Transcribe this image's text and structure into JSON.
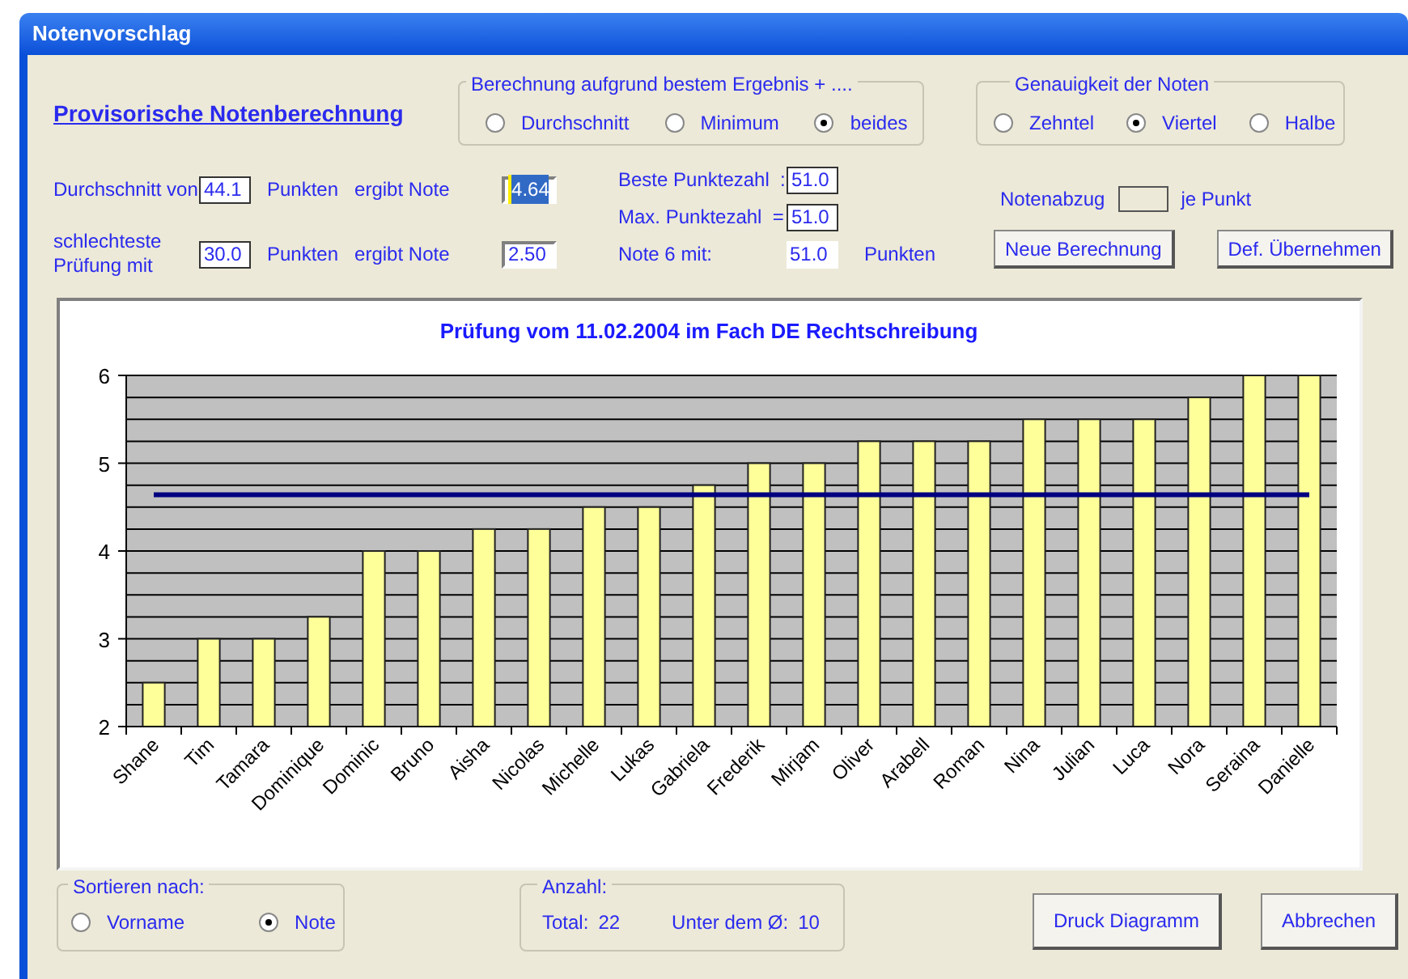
{
  "window": {
    "title": "Notenvorschlag"
  },
  "heading": "Provisorische Notenberechnung",
  "calc_group": {
    "title": "Berechnung aufgrund bestem Ergebnis + ....",
    "options": [
      {
        "label": "Durchschnitt",
        "selected": false
      },
      {
        "label": "Minimum",
        "selected": false
      },
      {
        "label": "beides",
        "selected": true
      }
    ]
  },
  "precision_group": {
    "title": "Genauigkeit der Noten",
    "options": [
      {
        "label": "Zehntel",
        "selected": false
      },
      {
        "label": "Viertel",
        "selected": true
      },
      {
        "label": "Halbe",
        "selected": false
      }
    ]
  },
  "average_row": {
    "label": "Durchschnitt von",
    "points": "44.1",
    "points_unit": "Punkten",
    "result_label": "ergibt Note",
    "grade": "4.64",
    "grade_highlighted": true
  },
  "worst_row": {
    "label_lines": [
      "schlechteste",
      "Prüfung mit"
    ],
    "points": "30.0",
    "points_unit": "Punkten",
    "result_label": "ergibt Note",
    "grade": "2.50",
    "grade_highlighted": false
  },
  "best_score": {
    "label": "Beste Punktezahl  :",
    "value": "51.0"
  },
  "max_score": {
    "label": "Max. Punktezahl  =",
    "value": "51.0"
  },
  "grade6": {
    "label": "Note 6 mit:",
    "value": "51.0",
    "unit": "Punkten"
  },
  "deduction": {
    "label": "Notenabzug",
    "unit": "je Punkt"
  },
  "top_buttons": [
    "Neue Berechnung",
    "Def. Übernehmen"
  ],
  "chart_data": {
    "type": "bar",
    "title": "Prüfung vom 11.02.2004 im Fach DE Rechtschreibung",
    "categories": [
      "Shane",
      "Tim",
      "Tamara",
      "Dominique",
      "Dominic",
      "Bruno",
      "Aisha",
      "Nicolas",
      "Michelle",
      "Lukas",
      "Gabriela",
      "Frederik",
      "Mirjam",
      "Oliver",
      "Arabell",
      "Roman",
      "Nina",
      "Julian",
      "Luca",
      "Nora",
      "Seraina",
      "Danielle"
    ],
    "series": [
      {
        "color": "#ffff99",
        "values": [
          2.5,
          3,
          3,
          3.25,
          4,
          4,
          4.25,
          4.25,
          4.5,
          4.5,
          4.75,
          5,
          5,
          5.25,
          5.25,
          5.25,
          5.5,
          5.5,
          5.5,
          5.75,
          6,
          6
        ]
      },
      {
        "type": "line",
        "color": "#000080",
        "values": [
          4.64,
          4.64,
          4.64,
          4.64,
          4.64,
          4.64,
          4.64,
          4.64,
          4.64,
          4.64,
          4.64,
          4.64,
          4.64,
          4.64,
          4.64,
          4.64,
          4.64,
          4.64,
          4.64,
          4.64,
          4.64,
          4.64
        ]
      }
    ],
    "ylim": [
      2,
      6
    ],
    "yticks": [
      2,
      3,
      4,
      5,
      6
    ],
    "grid": true
  },
  "sort_group": {
    "title": "Sortieren nach:",
    "options": [
      {
        "label": "Vorname",
        "selected": false
      },
      {
        "label": "Note",
        "selected": true
      }
    ]
  },
  "count_group": {
    "title": "Anzahl:",
    "total_label": "Total:",
    "total": "22",
    "below_label": "Unter dem Ø:",
    "below": "10"
  },
  "bottom_buttons": [
    "Druck Diagramm",
    "Abbrechen"
  ]
}
